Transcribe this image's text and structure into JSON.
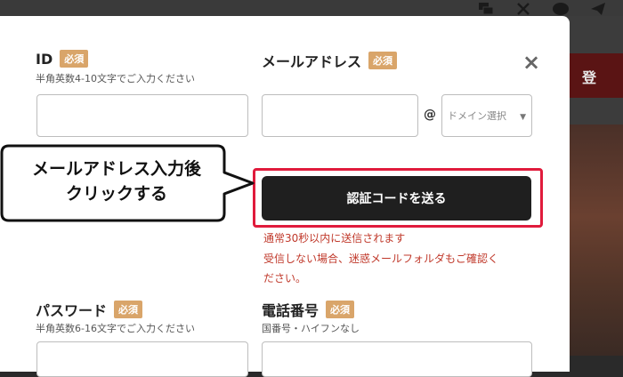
{
  "background": {
    "right_button_label": "登"
  },
  "modal": {
    "close_glyph": "×",
    "id_field": {
      "label": "ID",
      "badge": "必須",
      "hint": "半角英数4-10文字でご入力ください",
      "value": ""
    },
    "email_field": {
      "label": "メールアドレス",
      "badge": "必須",
      "local_value": "",
      "at": "@",
      "domain_placeholder": "ドメイン選択"
    },
    "send_code_button": "認証コードを送る",
    "notice_line1": "通常30秒以内に送信されます",
    "notice_line2": "受信しない場合、迷惑メールフォルダもご確認く",
    "notice_line3": "ださい。",
    "password_field": {
      "label": "パスワード",
      "badge": "必須",
      "hint": "半角英数6-16文字でご入力ください"
    },
    "phone_field": {
      "label": "電話番号",
      "badge": "必須",
      "hint": "国番号・ハイフンなし"
    }
  },
  "callout": {
    "line1": "メールアドレス入力後",
    "line2": "クリックする"
  },
  "colors": {
    "highlight": "#e01b3c",
    "badge": "#d9a56a",
    "notice": "#c0392b",
    "button": "#1f1f1f"
  }
}
